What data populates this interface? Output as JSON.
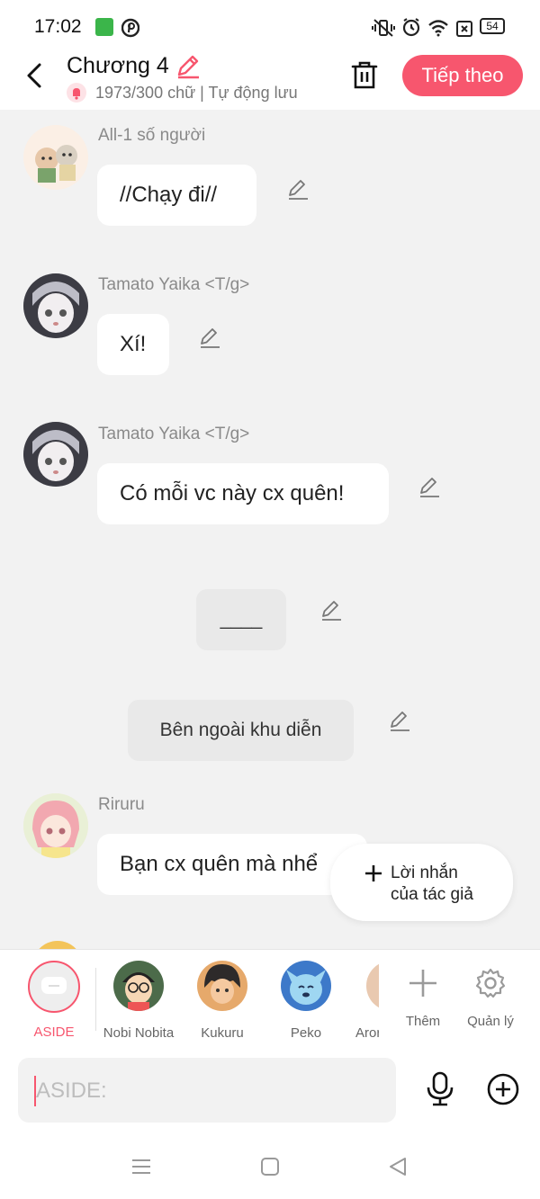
{
  "status": {
    "time": "17:02",
    "battery": "54"
  },
  "header": {
    "title": "Chương 4",
    "subtitle": "1973/300 chữ | Tự động lưu",
    "next_label": "Tiếp theo"
  },
  "messages": [
    {
      "name": "All-1 số người",
      "text": "//Chạy đi//"
    },
    {
      "name": "Tamato Yaika <T/g>",
      "text": "Xí!"
    },
    {
      "name": "Tamato Yaika <T/g>",
      "text": "Có mỗi vc này cx quên!"
    },
    {
      "text": "____"
    },
    {
      "text": "Bên ngoài khu diễn"
    },
    {
      "name": "Riruru",
      "text": "Bạn cx quên mà nhể"
    }
  ],
  "fab": {
    "line1": "Lời nhắn",
    "line2": "của tác giả"
  },
  "characters": [
    {
      "label": "ASIDE"
    },
    {
      "label": "Nobi Nobita"
    },
    {
      "label": "Kukuru"
    },
    {
      "label": "Peko"
    },
    {
      "label": "Aror"
    }
  ],
  "actions": {
    "add_label": "Thêm",
    "manage_label": "Quản lý"
  },
  "input": {
    "placeholder": "ASIDE:"
  },
  "colors": {
    "accent": "#f7566e",
    "background": "#f2f2f2"
  }
}
